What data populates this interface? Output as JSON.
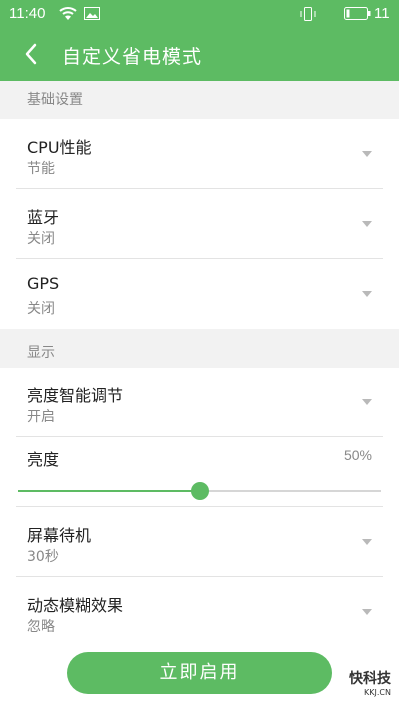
{
  "status_bar": {
    "time": "11:40",
    "battery_level": "11",
    "icons": [
      "wifi-icon",
      "image-icon",
      "vibrate-icon",
      "battery-icon"
    ]
  },
  "header": {
    "title": "自定义省电模式",
    "back_icon": "chevron-left-icon"
  },
  "sections": {
    "basic": {
      "title": "基础设置"
    },
    "display": {
      "title": "显示"
    }
  },
  "rows": {
    "cpu": {
      "label": "CPU性能",
      "value": "节能"
    },
    "bluetooth": {
      "label": "蓝牙",
      "value": "关闭"
    },
    "gps": {
      "label": "GPS",
      "value": "关闭"
    },
    "smart_brightness": {
      "label": "亮度智能调节",
      "value": "开启"
    },
    "brightness": {
      "label": "亮度",
      "percent": "50%",
      "level": 0.5
    },
    "screen_timeout": {
      "label": "屏幕待机",
      "value": "30秒"
    },
    "blur": {
      "label": "动态模糊效果",
      "value": "忽略"
    }
  },
  "footer": {
    "enable_label": "立即启用"
  },
  "watermark": {
    "name": "快科技",
    "domain": "KKJ.CN"
  },
  "colors": {
    "accent": "#5dbb63",
    "background": "#f2f2f2",
    "text": "#222222",
    "subtext": "#888888"
  }
}
